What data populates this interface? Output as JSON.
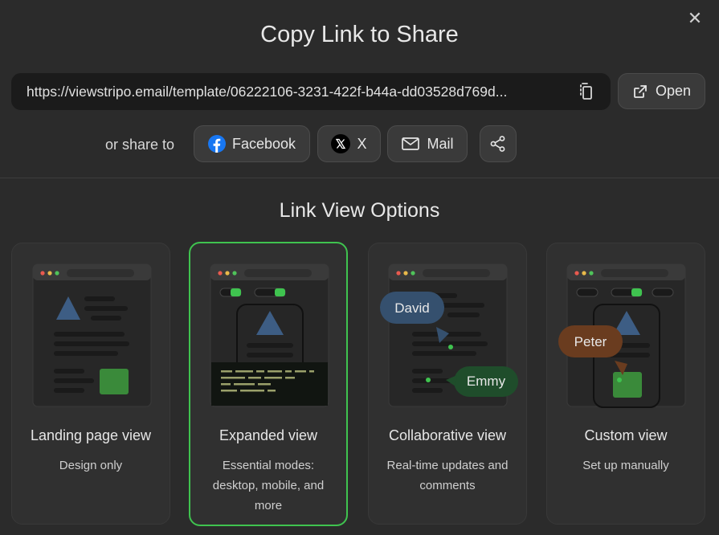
{
  "dialog": {
    "title": "Copy Link to Share",
    "close_icon": "close-icon"
  },
  "link": {
    "url": "https://viewstripo.email/template/06222106-3231-422f-b44a-dd03528d769d...",
    "copy_icon": "copy-icon",
    "open_label": "Open",
    "open_icon": "external-link-icon"
  },
  "share": {
    "label": "or share to",
    "buttons": [
      {
        "label": "Facebook",
        "icon": "facebook-icon"
      },
      {
        "label": "X",
        "icon": "x-logo-icon"
      },
      {
        "label": "Mail",
        "icon": "mail-icon"
      },
      {
        "label": "",
        "icon": "share-icon"
      }
    ]
  },
  "options": {
    "title": "Link View Options",
    "cards": [
      {
        "name": "Landing page view",
        "description": "Design only",
        "selected": false
      },
      {
        "name": "Expanded view",
        "description": "Essential modes: desktop, mobile, and more",
        "selected": true
      },
      {
        "name": "Collaborative view",
        "description": "Real-time updates and comments",
        "selected": false,
        "avatars": [
          "David",
          "Emmy"
        ]
      },
      {
        "name": "Custom view",
        "description": "Set up manually",
        "selected": false,
        "avatars": [
          "Peter"
        ]
      }
    ]
  },
  "colors": {
    "accent_green": "#3fc34f",
    "background": "#2b2b2b",
    "david_bubble": "#35506e",
    "emmy_bubble": "#1f4d2b",
    "peter_bubble": "#6a3c1f",
    "facebook_blue": "#1877f2"
  }
}
